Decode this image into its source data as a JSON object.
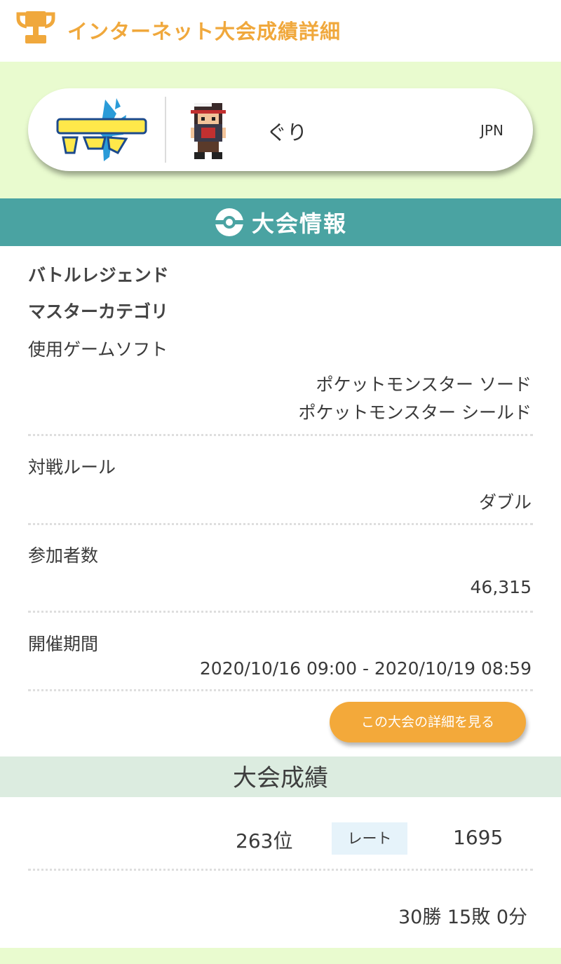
{
  "header": {
    "title": "インターネット大会成績詳細",
    "icon": "trophy-icon",
    "accent_color": "#f0a83c"
  },
  "player": {
    "game_logo": "pokemon-sword-logo",
    "name": "ぐり",
    "country": "JPN"
  },
  "tournament_section": {
    "title": "大会情報",
    "icon": "poke-ball-icon",
    "bar_color": "#4aa3a2",
    "name_line1": "バトルレジェンド",
    "name_line2": "マスターカテゴリ",
    "fields": [
      {
        "label": "使用ゲームソフト",
        "values": [
          "ポケットモンスター ソード",
          "ポケットモンスター シールド"
        ]
      },
      {
        "label": "対戦ルール",
        "values": [
          "ダブル"
        ]
      },
      {
        "label": "参加者数",
        "values": [
          "46,315"
        ]
      },
      {
        "label": "開催期間",
        "values": [
          "2020/10/16 09:00 - 2020/10/19 08:59"
        ]
      }
    ],
    "detail_button": "この大会の詳細を見る"
  },
  "results": {
    "title": "大会成績",
    "rank": "263位",
    "rate_label": "レート",
    "rate_value": "1695",
    "record": "30勝 15敗 0分"
  }
}
